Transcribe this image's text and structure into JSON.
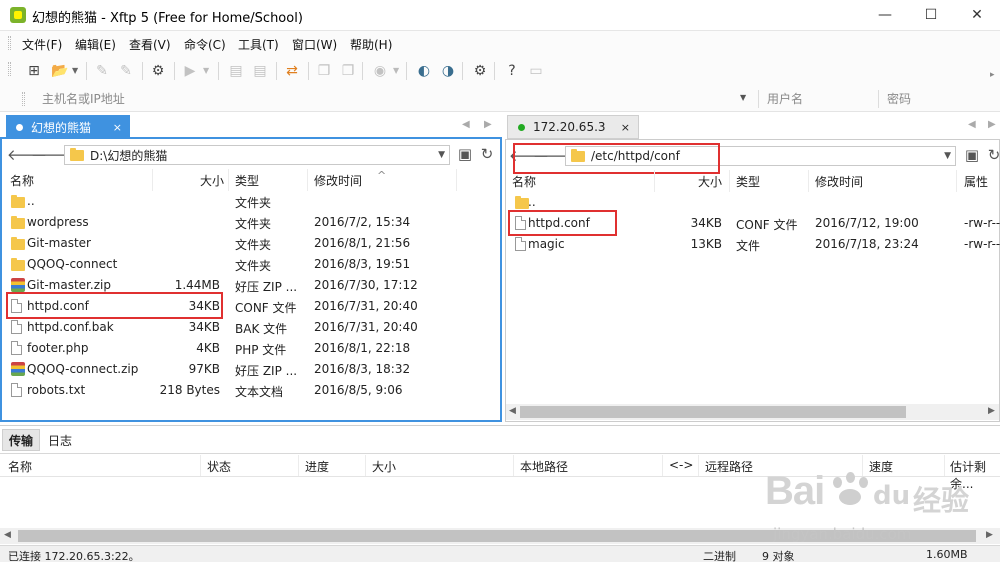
{
  "window": {
    "title": "幻想的熊猫 - Xftp 5 (Free for Home/School)",
    "min_glyph": "—",
    "max_glyph": "☐",
    "close_glyph": "✕"
  },
  "menu": [
    "文件(F)",
    "编辑(E)",
    "查看(V)",
    "命令(C)",
    "工具(T)",
    "窗口(W)",
    "帮助(H)"
  ],
  "address": {
    "host_placeholder": "主机名或IP地址",
    "user_placeholder": "用户名",
    "password_placeholder": "密码"
  },
  "left_tab": {
    "label": "幻想的熊猫",
    "close": "×"
  },
  "right_tab": {
    "label": "172.20.65.3",
    "close": "×"
  },
  "left_pane": {
    "path": "D:\\幻想的熊猫",
    "columns": [
      "名称",
      "大小",
      "类型",
      "修改时间"
    ],
    "rows": [
      {
        "icon": "folder",
        "name": "..",
        "size": "",
        "type": "文件夹",
        "time": ""
      },
      {
        "icon": "folder",
        "name": "wordpress",
        "size": "",
        "type": "文件夹",
        "time": "2016/7/2, 15:34"
      },
      {
        "icon": "folder",
        "name": "Git-master",
        "size": "",
        "type": "文件夹",
        "time": "2016/8/1, 21:56"
      },
      {
        "icon": "folder",
        "name": "QQOQ-connect",
        "size": "",
        "type": "文件夹",
        "time": "2016/8/3, 19:51"
      },
      {
        "icon": "zip",
        "name": "Git-master.zip",
        "size": "1.44MB",
        "type": "好压 ZIP ...",
        "time": "2016/7/30, 17:12"
      },
      {
        "icon": "file",
        "name": "httpd.conf",
        "size": "34KB",
        "type": "CONF 文件",
        "time": "2016/7/31, 20:40"
      },
      {
        "icon": "file",
        "name": "httpd.conf.bak",
        "size": "34KB",
        "type": "BAK 文件",
        "time": "2016/7/31, 20:40"
      },
      {
        "icon": "file",
        "name": "footer.php",
        "size": "4KB",
        "type": "PHP 文件",
        "time": "2016/8/1, 22:18"
      },
      {
        "icon": "zip",
        "name": "QQOQ-connect.zip",
        "size": "97KB",
        "type": "好压 ZIP ...",
        "time": "2016/8/3, 18:32"
      },
      {
        "icon": "file",
        "name": "robots.txt",
        "size": "218 Bytes",
        "type": "文本文档",
        "time": "2016/8/5, 9:06"
      }
    ]
  },
  "right_pane": {
    "path": "/etc/httpd/conf",
    "columns": [
      "名称",
      "大小",
      "类型",
      "修改时间",
      "属性"
    ],
    "rows": [
      {
        "icon": "folder",
        "name": "..",
        "size": "",
        "type": "",
        "time": "",
        "attr": ""
      },
      {
        "icon": "file",
        "name": "httpd.conf",
        "size": "34KB",
        "type": "CONF 文件",
        "time": "2016/7/12, 19:00",
        "attr": "-rw-r--"
      },
      {
        "icon": "file",
        "name": "magic",
        "size": "13KB",
        "type": "文件",
        "time": "2016/7/18, 23:24",
        "attr": "-rw-r--"
      }
    ]
  },
  "transfer": {
    "tabs": [
      "传输",
      "日志"
    ],
    "columns": [
      "名称",
      "状态",
      "进度",
      "大小",
      "本地路径",
      "<->",
      "远程路径",
      "速度",
      "估计剩余..."
    ]
  },
  "status": {
    "connection": "已连接 172.20.65.3:22。",
    "mode": "二进制",
    "objects": "9 对象",
    "size": "1.60MB"
  },
  "watermark": {
    "brand": "Bai",
    "brand_tail": "经验",
    "url": "jingyan.baidu.com"
  },
  "colors": {
    "accent": "#3f92e0",
    "highlight": "#e03030",
    "folder": "#f5c74b",
    "connected": "#22aa22"
  }
}
